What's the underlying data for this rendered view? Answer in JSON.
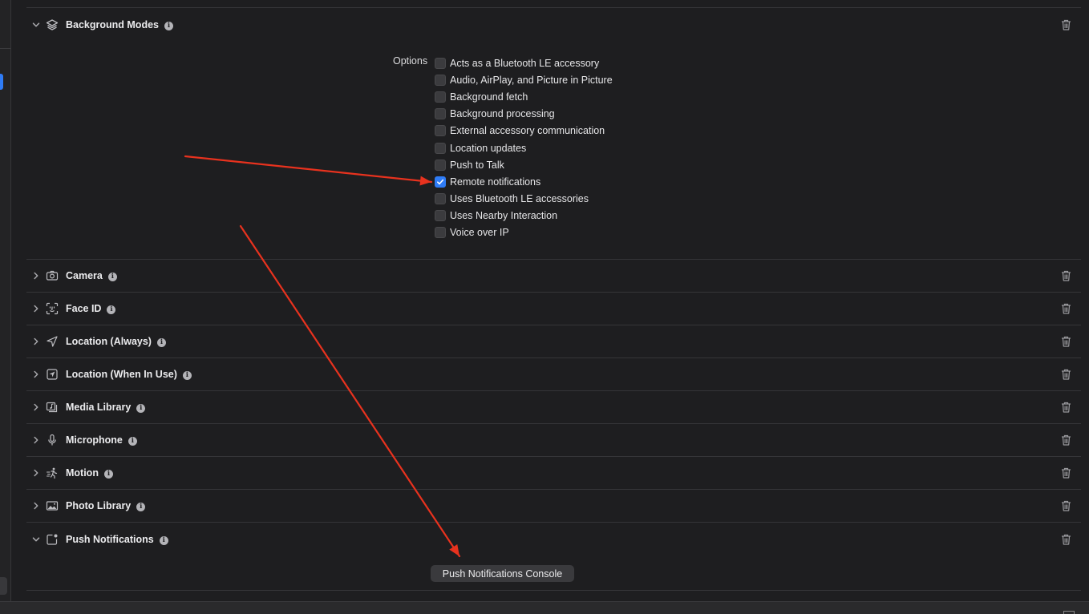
{
  "background_modes": {
    "title": "Background Modes",
    "options_label": "Options",
    "options": [
      {
        "label": "Acts as a Bluetooth LE accessory",
        "checked": false
      },
      {
        "label": "Audio, AirPlay, and Picture in Picture",
        "checked": false
      },
      {
        "label": "Background fetch",
        "checked": false
      },
      {
        "label": "Background processing",
        "checked": false
      },
      {
        "label": "External accessory communication",
        "checked": false
      },
      {
        "label": "Location updates",
        "checked": false
      },
      {
        "label": "Push to Talk",
        "checked": false
      },
      {
        "label": "Remote notifications",
        "checked": true
      },
      {
        "label": "Uses Bluetooth LE accessories",
        "checked": false
      },
      {
        "label": "Uses Nearby Interaction",
        "checked": false
      },
      {
        "label": "Voice over IP",
        "checked": false
      }
    ]
  },
  "capabilities": [
    {
      "title": "Camera",
      "icon": "camera-icon",
      "expanded": false
    },
    {
      "title": "Face ID",
      "icon": "face-id-icon",
      "expanded": false
    },
    {
      "title": "Location (Always)",
      "icon": "location-arrow-icon",
      "expanded": false
    },
    {
      "title": "Location (When In Use)",
      "icon": "location-square-icon",
      "expanded": false
    },
    {
      "title": "Media Library",
      "icon": "media-library-icon",
      "expanded": false
    },
    {
      "title": "Microphone",
      "icon": "microphone-icon",
      "expanded": false
    },
    {
      "title": "Motion",
      "icon": "motion-icon",
      "expanded": false
    },
    {
      "title": "Photo Library",
      "icon": "photo-icon",
      "expanded": false
    },
    {
      "title": "Push Notifications",
      "icon": "push-notification-icon",
      "expanded": true
    }
  ],
  "push_notifications": {
    "console_button": "Push Notifications Console"
  },
  "colors": {
    "background": "#1e1e20",
    "accent": "#2f7cf6",
    "annotation_arrow": "#e8321e"
  }
}
